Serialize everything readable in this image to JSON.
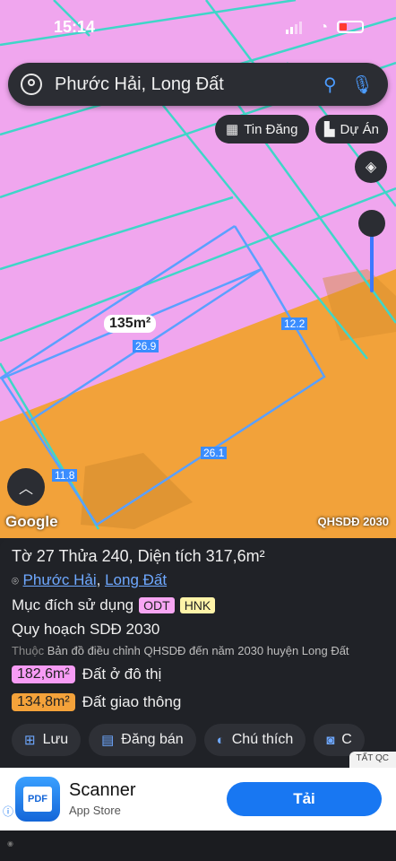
{
  "status_bar": {
    "time": "15:14"
  },
  "search": {
    "query": "Phước Hải, Long Đất"
  },
  "map_buttons": {
    "listings": "Tin Đăng",
    "projects": "Dự Án"
  },
  "map_labels": {
    "area_label": "135m²",
    "dim_a": "26.9",
    "dim_b": "12.2",
    "dim_c": "26.1",
    "dim_d": "11.8",
    "google": "Google",
    "layer": "QHSDĐ 2030"
  },
  "parcel": {
    "title": "Tờ 27 Thửa 240, Diện tích 317,6m²",
    "ward": "Phước Hải",
    "separator": ",",
    "district": "Long Đất",
    "purpose_label": "Mục đích sử dụng",
    "purpose_codes": [
      {
        "code": "ODT",
        "color": "#f7a6f3"
      },
      {
        "code": "HNK",
        "color": "#fff4a8"
      }
    ],
    "plan_title": "Quy hoạch SDĐ 2030",
    "source_prefix": "Thuộc",
    "source_text": "Bản đồ điều chỉnh QHSDĐ đến năm 2030 huyện Long Đất",
    "areas": [
      {
        "value": "182,6m²",
        "label": "Đất ở đô thị",
        "color": "#f79cf5"
      },
      {
        "value": "134,8m²",
        "label": "Đất giao thông",
        "color": "#f4a23a"
      }
    ]
  },
  "actions": [
    "Lưu",
    "Đăng bán",
    "Chú thích",
    "C"
  ],
  "ad": {
    "tag": "TẤT QC",
    "icon_text": "PDF",
    "app_name": "Scanner",
    "store": "App Store",
    "cta": "Tải"
  },
  "colors": {
    "accent": "#4c9cff",
    "residential": "#f2a2ef",
    "transport": "#f2a23a"
  }
}
